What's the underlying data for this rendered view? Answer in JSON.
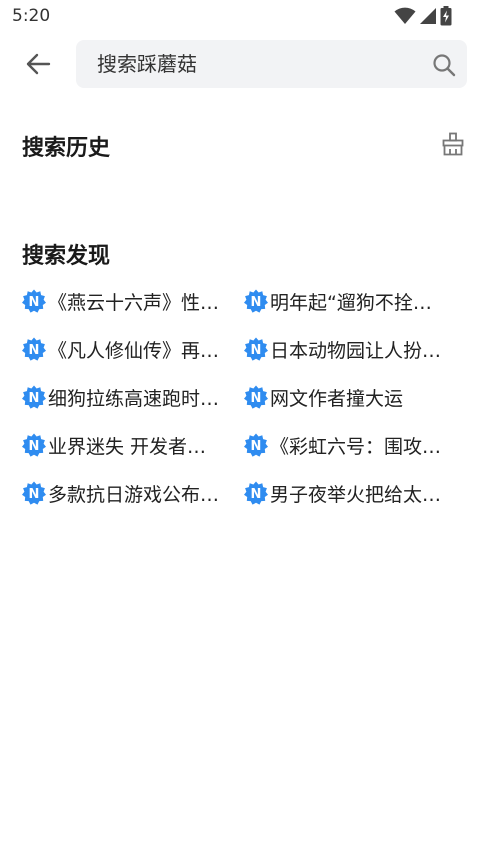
{
  "status_bar": {
    "time": "5:20",
    "icons": [
      "wifi-icon",
      "cellular-signal-icon",
      "battery-charging-icon"
    ]
  },
  "header": {
    "back_icon": "arrow-left-icon",
    "search": {
      "placeholder": "搜索踩蘑菇",
      "value": ""
    },
    "search_icon": "search-icon"
  },
  "history": {
    "title": "搜索历史",
    "clear_icon": "broom-clear-icon"
  },
  "discover": {
    "title": "搜索发现",
    "badge_icon": "new-badge-icon",
    "badge_letter": "N",
    "items": [
      {
        "label": "《燕云十六声》性…"
      },
      {
        "label": "明年起“遛狗不拴…"
      },
      {
        "label": "《凡人修仙传》再…"
      },
      {
        "label": "日本动物园让人扮…"
      },
      {
        "label": "细狗拉练高速跑时…"
      },
      {
        "label": "网文作者撞大运"
      },
      {
        "label": "业界迷失 开发者…"
      },
      {
        "label": "《彩虹六号：围攻…"
      },
      {
        "label": "多款抗日游戏公布…"
      },
      {
        "label": "男子夜举火把给太…"
      }
    ]
  },
  "colors": {
    "badge_blue": "#2f8cf0",
    "search_bg": "#f2f3f5",
    "text_primary": "#222222",
    "icon_gray": "#666666"
  }
}
